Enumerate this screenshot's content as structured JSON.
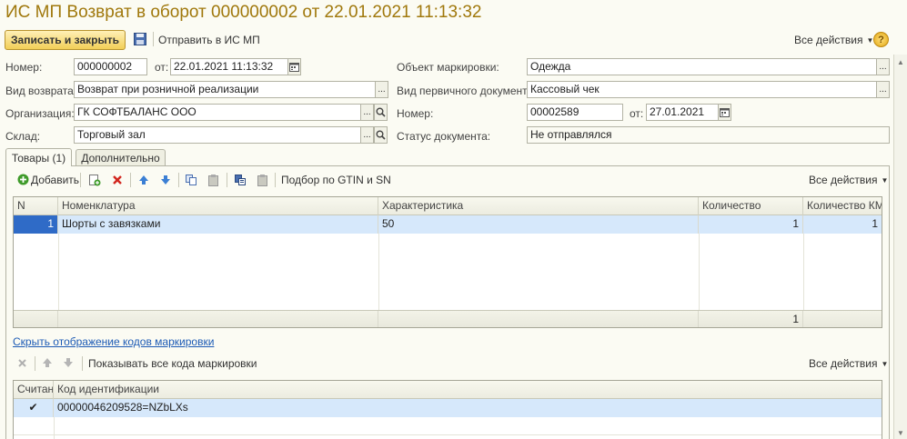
{
  "window": {
    "title": "ИС МП Возврат в оборот 000000002 от 22.01.2021 11:13:32"
  },
  "toolbar": {
    "save_close": "Записать и закрыть",
    "send": "Отправить в ИС МП",
    "all_actions": "Все действия",
    "help": "?"
  },
  "form": {
    "number_label": "Номер:",
    "number_value": "000000002",
    "date_label": "от:",
    "date_value": "22.01.2021 11:13:32",
    "object_label": "Объект маркировки:",
    "object_value": "Одежда",
    "return_type_label": "Вид возврата:",
    "return_type_value": "Возврат при розничной реализации",
    "primary_doc_label": "Вид первичного документа:",
    "primary_doc_value": "Кассовый чек",
    "org_label": "Организация:",
    "org_value": "ГК СОФТБАЛАНС ООО",
    "doc_number_label": "Номер:",
    "doc_number_value": "00002589",
    "doc_date_label": "от:",
    "doc_date_value": "27.01.2021",
    "warehouse_label": "Склад:",
    "warehouse_value": "Торговый зал",
    "status_label": "Статус документа:",
    "status_value": "Не отправлялся"
  },
  "tabs": [
    {
      "label": "Товары (1)"
    },
    {
      "label": "Дополнительно"
    }
  ],
  "goods_toolbar": {
    "add": "Добавить",
    "gtin": "Подбор по GTIN и SN",
    "all_actions": "Все действия"
  },
  "goods_table": {
    "columns": [
      "N",
      "Номенклатура",
      "Характеристика",
      "Количество",
      "Количество КМ"
    ],
    "rows": [
      {
        "n": "1",
        "item": "Шорты с завязками",
        "char": "50",
        "qty": "1",
        "qty_km": "1"
      }
    ],
    "footer_qty": "1"
  },
  "codes": {
    "hide_link": "Скрыть отображение кодов маркировки",
    "show_all": "Показывать все кода маркировки",
    "all_actions": "Все действия",
    "columns": [
      "Считан",
      "Код идентификации"
    ],
    "rows": [
      {
        "read": "✔",
        "code": "00000046209528=NZbLXs"
      }
    ]
  }
}
